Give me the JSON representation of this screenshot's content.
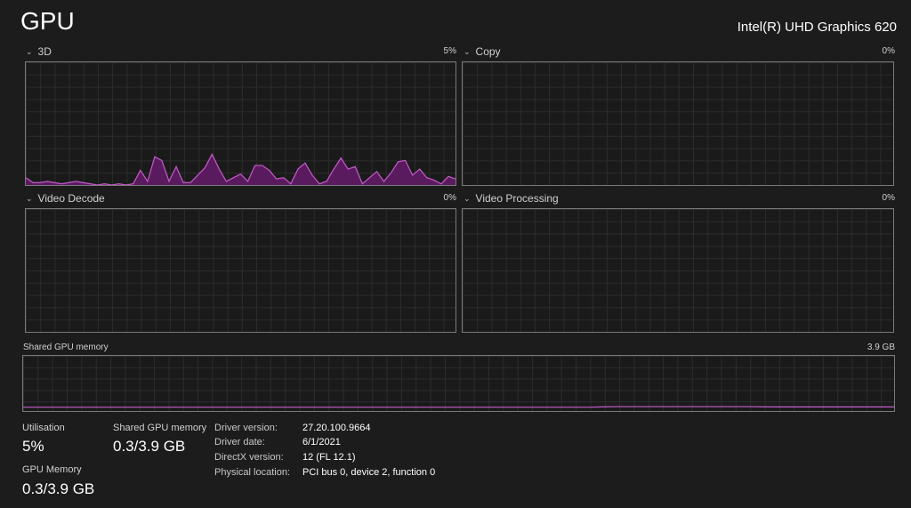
{
  "header": {
    "title": "GPU",
    "device": "Intel(R) UHD Graphics 620"
  },
  "graphs": {
    "3d": {
      "label": "3D",
      "percent": "5%"
    },
    "copy": {
      "label": "Copy",
      "percent": "0%"
    },
    "video_decode": {
      "label": "Video Decode",
      "percent": "0%"
    },
    "video_processing": {
      "label": "Video Processing",
      "percent": "0%"
    },
    "shared_memory": {
      "label": "Shared GPU memory",
      "max": "3.9 GB"
    }
  },
  "stats": {
    "utilisation": {
      "label": "Utilisation",
      "value": "5%"
    },
    "shared_gpu_memory": {
      "label": "Shared GPU memory",
      "value": "0.3/3.9 GB"
    },
    "gpu_memory": {
      "label": "GPU Memory",
      "value": "0.3/3.9 GB"
    }
  },
  "info": {
    "driver_version": {
      "label": "Driver version:",
      "value": "27.20.100.9664"
    },
    "driver_date": {
      "label": "Driver date:",
      "value": "6/1/2021"
    },
    "directx_version": {
      "label": "DirectX version:",
      "value": "12 (FL 12.1)"
    },
    "physical_location": {
      "label": "Physical location:",
      "value": "PCI bus 0, device 2, function 0"
    }
  },
  "colors": {
    "accent": "#c45ccc",
    "fill": "#5a1b5e",
    "grid": "#2c2c2c",
    "border": "#7a7a7a"
  },
  "chart_data": [
    {
      "type": "area",
      "title": "3D",
      "ylim": [
        0,
        100
      ],
      "values": [
        6,
        2,
        2,
        3,
        2,
        1,
        2,
        3,
        2,
        1,
        0,
        1,
        0,
        1,
        0,
        1,
        12,
        3,
        23,
        20,
        3,
        15,
        2,
        2,
        8,
        14,
        25,
        13,
        3,
        6,
        9,
        3,
        16,
        16,
        12,
        5,
        6,
        1,
        13,
        18,
        8,
        1,
        3,
        13,
        22,
        13,
        15,
        1,
        6,
        11,
        3,
        10,
        19,
        20,
        8,
        13,
        6,
        4,
        1,
        7,
        5
      ]
    },
    {
      "type": "line",
      "title": "Shared GPU memory",
      "ylim": [
        0,
        3.9
      ],
      "values": [
        0.27,
        0.27,
        0.27,
        0.27,
        0.27,
        0.27,
        0.27,
        0.27,
        0.27,
        0.27,
        0.27,
        0.27,
        0.27,
        0.27,
        0.27,
        0.27,
        0.27,
        0.27,
        0.27,
        0.27,
        0.27,
        0.27,
        0.27,
        0.27,
        0.27,
        0.27,
        0.27,
        0.27,
        0.27,
        0.27,
        0.27,
        0.27,
        0.27,
        0.27,
        0.27,
        0.27,
        0.27,
        0.27,
        0.27,
        0.27,
        0.3,
        0.31,
        0.31,
        0.31,
        0.31,
        0.31,
        0.31,
        0.31,
        0.31,
        0.31,
        0.31,
        0.3,
        0.29,
        0.29,
        0.29,
        0.29,
        0.29,
        0.29,
        0.29,
        0.29,
        0.29
      ]
    }
  ]
}
